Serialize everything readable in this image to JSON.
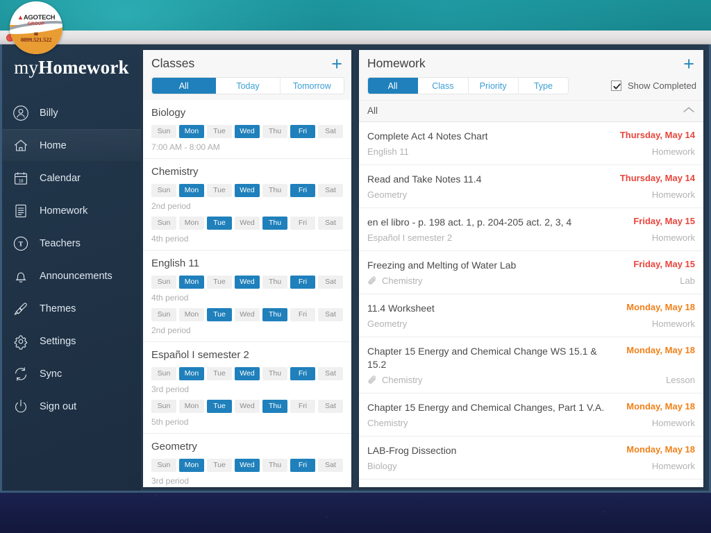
{
  "window": {
    "close_label": "close"
  },
  "sticker": {
    "brand": "AGOTECH",
    "brand_sub": "GROUP",
    "phone": "0899.521.522"
  },
  "sidebar": {
    "brand_light": "my",
    "brand_bold": "Homework",
    "items": [
      {
        "label": "Billy",
        "icon": "user-icon",
        "active": false
      },
      {
        "label": "Home",
        "icon": "home-icon",
        "active": true
      },
      {
        "label": "Calendar",
        "icon": "calendar-icon",
        "active": false
      },
      {
        "label": "Homework",
        "icon": "document-icon",
        "active": false
      },
      {
        "label": "Teachers",
        "icon": "teacher-icon",
        "active": false
      },
      {
        "label": "Announcements",
        "icon": "bell-icon",
        "active": false
      },
      {
        "label": "Themes",
        "icon": "paintbrush-icon",
        "active": false
      },
      {
        "label": "Settings",
        "icon": "gear-icon",
        "active": false
      },
      {
        "label": "Sync",
        "icon": "sync-icon",
        "active": false
      },
      {
        "label": "Sign out",
        "icon": "power-icon",
        "active": false
      }
    ]
  },
  "classes_panel": {
    "title": "Classes",
    "add_label": "+",
    "tabs": [
      {
        "label": "All",
        "active": true
      },
      {
        "label": "Today",
        "active": false
      },
      {
        "label": "Tomorrow",
        "active": false
      }
    ],
    "day_labels": [
      "Sun",
      "Mon",
      "Tue",
      "Wed",
      "Thu",
      "Fri",
      "Sat"
    ],
    "classes": [
      {
        "name": "Biology",
        "schedules": [
          {
            "days": [
              false,
              true,
              false,
              true,
              false,
              true,
              false
            ],
            "period": "7:00 AM - 8:00 AM"
          }
        ]
      },
      {
        "name": "Chemistry",
        "schedules": [
          {
            "days": [
              false,
              true,
              false,
              true,
              false,
              true,
              false
            ],
            "period": "2nd period"
          },
          {
            "days": [
              false,
              false,
              true,
              false,
              true,
              false,
              false
            ],
            "period": "4th period"
          }
        ]
      },
      {
        "name": "English 11",
        "schedules": [
          {
            "days": [
              false,
              true,
              false,
              true,
              false,
              true,
              false
            ],
            "period": "4th period"
          },
          {
            "days": [
              false,
              false,
              true,
              false,
              true,
              false,
              false
            ],
            "period": "2nd period"
          }
        ]
      },
      {
        "name": "Español I semester 2",
        "schedules": [
          {
            "days": [
              false,
              true,
              false,
              true,
              false,
              true,
              false
            ],
            "period": "3rd period"
          },
          {
            "days": [
              false,
              false,
              true,
              false,
              true,
              false,
              false
            ],
            "period": "5th period"
          }
        ]
      },
      {
        "name": "Geometry",
        "schedules": [
          {
            "days": [
              false,
              true,
              false,
              true,
              false,
              true,
              false
            ],
            "period": "3rd period"
          }
        ]
      }
    ]
  },
  "homework_panel": {
    "title": "Homework",
    "add_label": "+",
    "tabs": [
      {
        "label": "All",
        "active": true
      },
      {
        "label": "Class",
        "active": false
      },
      {
        "label": "Priority",
        "active": false
      },
      {
        "label": "Type",
        "active": false
      }
    ],
    "show_completed": {
      "label": "Show Completed",
      "checked": true
    },
    "group": {
      "label": "All",
      "collapse_icon": "chevron-up-icon"
    },
    "colors": {
      "due_soon": "#e8453c",
      "due_later": "#f08019",
      "accent": "#1f80bb"
    },
    "items": [
      {
        "title": "Complete Act 4 Notes Chart",
        "class": "English 11",
        "date": "Thursday, May 14",
        "date_color": "#e8453c",
        "type": "Homework",
        "attachment": false
      },
      {
        "title": "Read and Take Notes 11.4",
        "class": "Geometry",
        "date": "Thursday, May 14",
        "date_color": "#e8453c",
        "type": "Homework",
        "attachment": false
      },
      {
        "title": "en el libro - p. 198 act. 1, p. 204-205 act. 2, 3, 4",
        "class": "Español I semester 2",
        "date": "Friday, May 15",
        "date_color": "#e8453c",
        "type": "Homework",
        "attachment": false
      },
      {
        "title": "Freezing and Melting of Water Lab",
        "class": "Chemistry",
        "date": "Friday, May 15",
        "date_color": "#e8453c",
        "type": "Lab",
        "attachment": true
      },
      {
        "title": "11.4 Worksheet",
        "class": "Geometry",
        "date": "Monday, May 18",
        "date_color": "#f08019",
        "type": "Homework",
        "attachment": false
      },
      {
        "title": "Chapter 15 Energy and Chemical Change WS 15.1 & 15.2",
        "class": "Chemistry",
        "date": "Monday, May 18",
        "date_color": "#f08019",
        "type": "Lesson",
        "attachment": true
      },
      {
        "title": "Chapter 15 Energy and Chemical Changes, Part 1 V.A.",
        "class": "Chemistry",
        "date": "Monday, May 18",
        "date_color": "#f08019",
        "type": "Homework",
        "attachment": false
      },
      {
        "title": "LAB-Frog Dissection",
        "class": "Biology",
        "date": "Monday, May 18",
        "date_color": "#f08019",
        "type": "Homework",
        "attachment": false
      }
    ]
  }
}
